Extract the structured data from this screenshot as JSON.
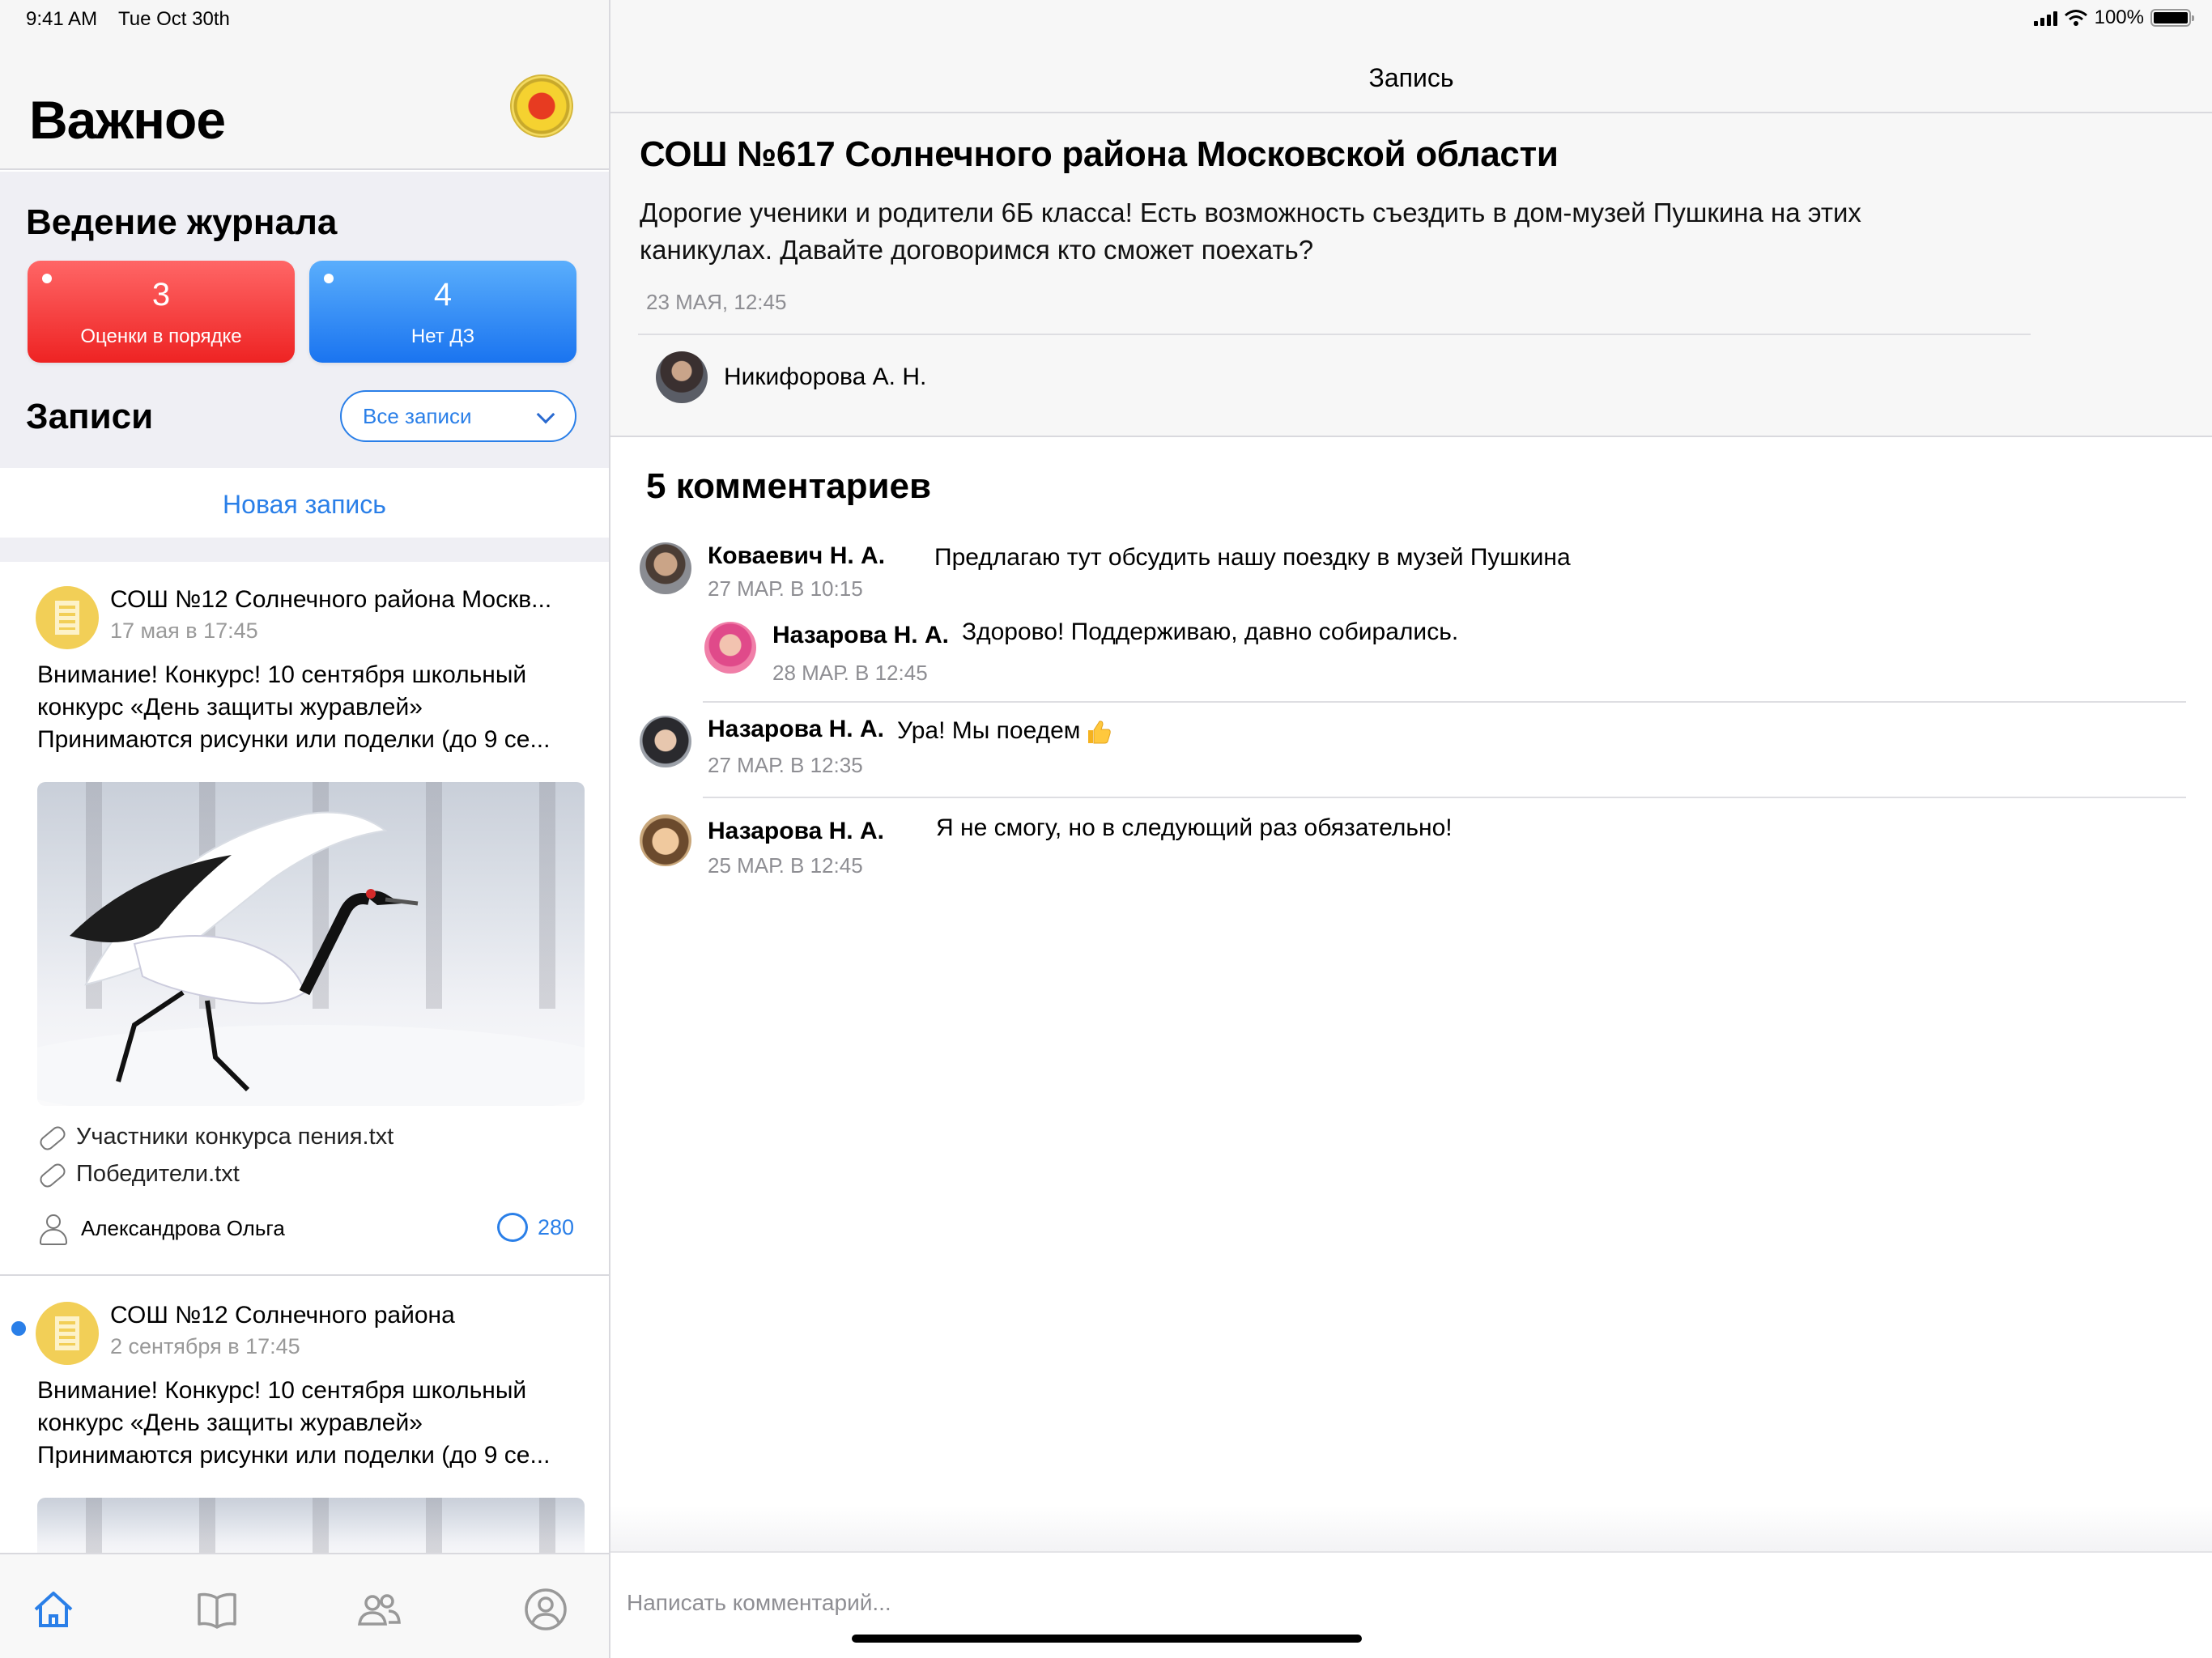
{
  "status_bar": {
    "time": "9:41 AM",
    "date": "Tue Oct 30th",
    "battery": "100%"
  },
  "left": {
    "title": "Важное",
    "journal": {
      "title": "Ведение журнала",
      "cards": [
        {
          "value": "3",
          "label": "Оценки в порядке",
          "color": "#f03535"
        },
        {
          "value": "4",
          "label": "Нет ДЗ",
          "color": "#2a7fe8"
        }
      ]
    },
    "records": {
      "title": "Записи",
      "filter": "Все записи",
      "new_record": "Новая запись"
    },
    "posts": [
      {
        "title": "СОШ №12 Солнечного района Москв...",
        "date": "17 мая в 17:45",
        "text": [
          "Внимание! Конкурс! 10 сентября школьный",
          "конкурс «День защиты журавлей»",
          "Принимаются рисунки или поделки (до 9 се..."
        ],
        "attachments": [
          "Участники конкурса пения.txt",
          "Победители.txt"
        ],
        "author": "Александрова Ольга",
        "comments": "280",
        "image_icon": "crane-photo"
      },
      {
        "title": "СОШ №12 Солнечного района",
        "date": "2 сентября в 17:45",
        "text": [
          "Внимание! Конкурс! 10 сентября школьный",
          "конкурс «День защиты журавлей»",
          "Принимаются рисунки или поделки (до 9 се..."
        ],
        "unread": true
      }
    ],
    "tabs": [
      "home-icon",
      "book-icon",
      "people-icon",
      "profile-icon"
    ]
  },
  "right": {
    "nav_title": "Запись",
    "record": {
      "title": "СОШ №617 Солнечного района Московской области",
      "body_lines": [
        "Дорогие ученики и родители 6Б класса! Есть возможность съездить в дом-музей Пушкина на этих",
        "каникулах. Давайте договоримся кто сможет поехать?"
      ],
      "date": "23 МАЯ, 12:45",
      "author": "Никифорова А. Н."
    },
    "comments_title": "5 комментариев",
    "comments": [
      {
        "name": "Коваевич Н. А.",
        "text": "Предлагаю тут обсудить нашу поездку в музей Пушкина",
        "date": "27 МАР. В 10:15"
      },
      {
        "name": "Назарова Н. А.",
        "text": "Здорово! Поддерживаю, давно собирались.",
        "date": "28 МАР. В 12:45"
      },
      {
        "name": "Назарова Н. А.",
        "text": "Ура! Мы поедем",
        "date": "27 МАР. В 12:35"
      },
      {
        "name": "Назарова Н. А.",
        "text": "Я не смогу, но в следующий раз обязательно!",
        "date": "25 МАР. В 12:45"
      }
    ],
    "input_placeholder": "Написать комментарий..."
  }
}
